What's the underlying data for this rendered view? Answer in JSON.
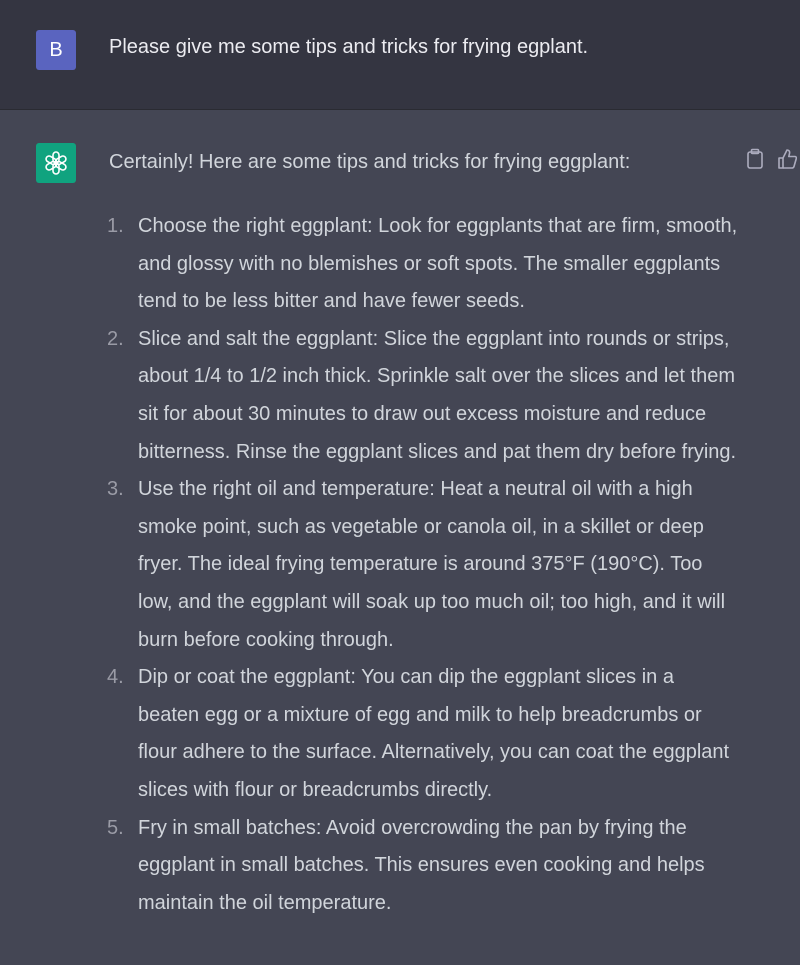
{
  "user_message": {
    "avatar_initial": "B",
    "text": "Please give me some tips and tricks for frying egplant."
  },
  "assistant_message": {
    "intro": "Certainly! Here are some tips and tricks for frying eggplant:",
    "icons": [
      "clipboard-icon",
      "thumbs-up-icon"
    ],
    "tips": [
      {
        "number": "1.",
        "text": "Choose the right eggplant: Look for eggplants that are firm, smooth, and glossy with no blemishes or soft spots. The smaller eggplants tend to be less bitter and have fewer seeds."
      },
      {
        "number": "2.",
        "text": "Slice and salt the eggplant: Slice the eggplant into rounds or strips, about 1/4 to 1/2 inch thick. Sprinkle salt over the slices and let them sit for about 30 minutes to draw out excess moisture and reduce bitterness. Rinse the eggplant slices and pat them dry before frying."
      },
      {
        "number": "3.",
        "text": "Use the right oil and temperature: Heat a neutral oil with a high smoke point, such as vegetable or canola oil, in a skillet or deep fryer. The ideal frying temperature is around 375°F (190°C). Too low, and the eggplant will soak up too much oil; too high, and it will burn before cooking through."
      },
      {
        "number": "4.",
        "text": "Dip or coat the eggplant: You can dip the eggplant slices in a beaten egg or a mixture of egg and milk to help breadcrumbs or flour adhere to the surface. Alternatively, you can coat the eggplant slices with flour or breadcrumbs directly."
      },
      {
        "number": "5.",
        "text": "Fry in small batches: Avoid overcrowding the pan by frying the eggplant in small batches. This ensures even cooking and helps maintain the oil temperature."
      }
    ]
  },
  "colors": {
    "user_background": "#343541",
    "assistant_background": "#444654",
    "user_avatar": "#5a64bf",
    "assistant_avatar": "#10a37f",
    "text": "#d1d5db"
  }
}
